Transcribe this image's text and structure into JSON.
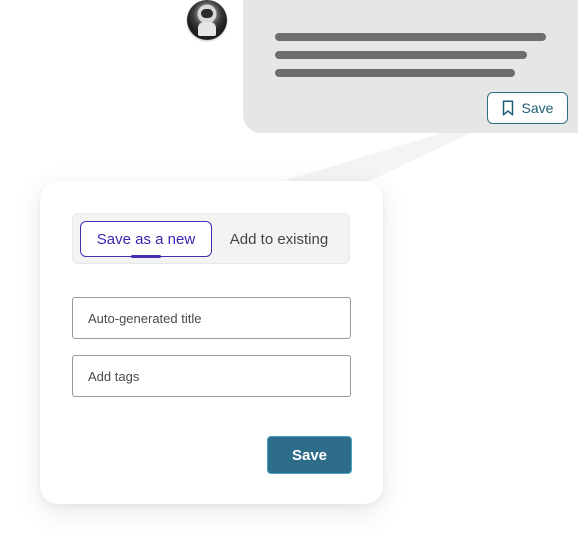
{
  "message": {
    "avatar_icon": "astronaut-avatar-icon",
    "save_button": {
      "label": "Save",
      "icon": "bookmark-icon"
    }
  },
  "save_dialog": {
    "tabs": [
      {
        "label": "Save as a new",
        "selected": true
      },
      {
        "label": "Add to existing",
        "selected": false
      }
    ],
    "title_field": {
      "placeholder": "Auto-generated title",
      "value": ""
    },
    "tags_field": {
      "placeholder": "Add tags",
      "value": ""
    },
    "save_button": {
      "label": "Save"
    }
  },
  "colors": {
    "accent": "#4a2bb5",
    "primary_button": "#2e6d89",
    "bubble_background": "#e6e6e6"
  }
}
